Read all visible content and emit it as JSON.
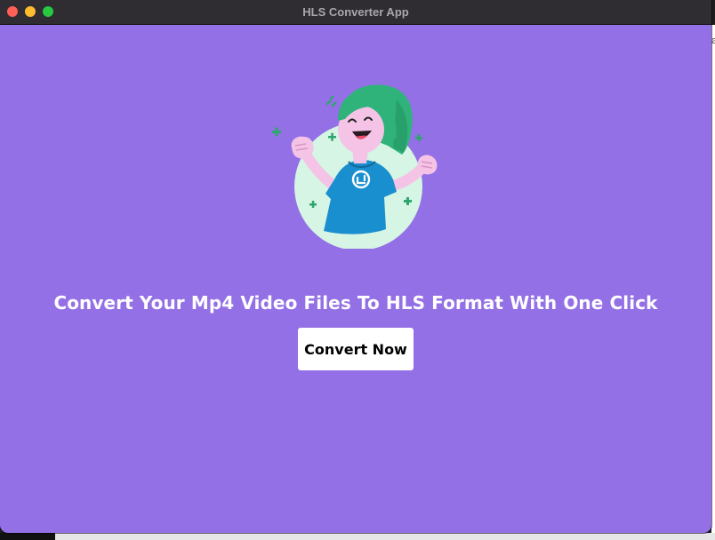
{
  "window": {
    "title": "HLS Converter App"
  },
  "main": {
    "headline": "Convert Your Mp4 Video Files To HLS Format With One Click",
    "convert_button_label": "Convert Now"
  },
  "background": {
    "edge_text": "a"
  },
  "colors": {
    "content_background": "#9370e5",
    "button_background": "#ffffff",
    "headline_text": "#ffffff",
    "illustration_hair": "#2fb37a",
    "illustration_shirt": "#1a8fd0",
    "illustration_circle": "#d6f5e4"
  },
  "icons": {
    "illustration": "celebrating-person-illustration",
    "shirt_logo": "upload-arrows-icon"
  }
}
